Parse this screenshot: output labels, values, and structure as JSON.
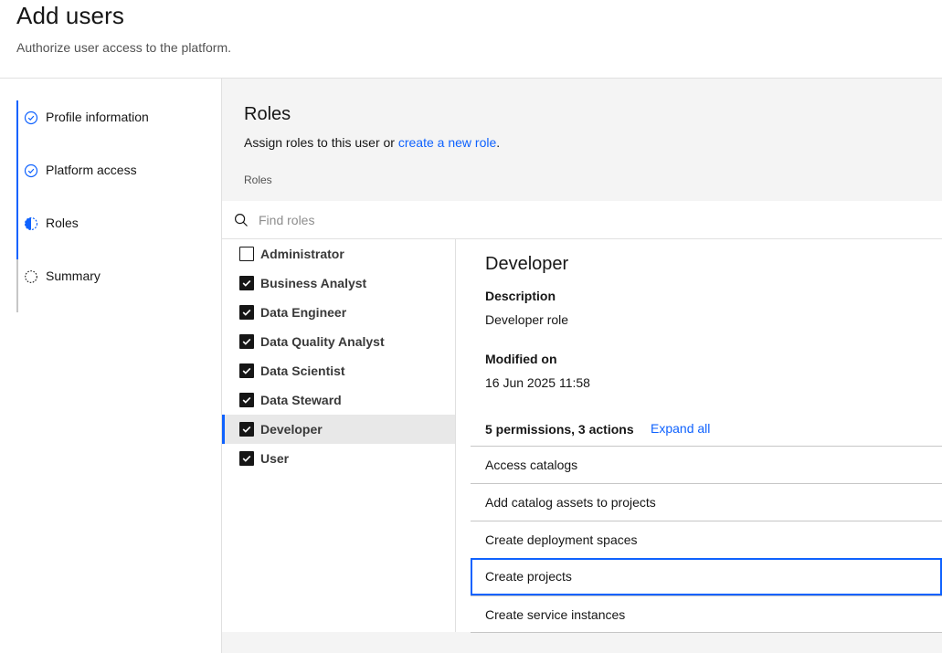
{
  "header": {
    "title": "Add users",
    "subtitle": "Authorize user access to the platform."
  },
  "steps": [
    {
      "label": "Profile information",
      "state": "complete",
      "icon": "checkmark-outline-icon"
    },
    {
      "label": "Platform access",
      "state": "complete",
      "icon": "checkmark-outline-icon"
    },
    {
      "label": "Roles",
      "state": "current",
      "icon": "incomplete-half-icon"
    },
    {
      "label": "Summary",
      "state": "incomplete",
      "icon": "circle-dash-icon"
    }
  ],
  "roles_section": {
    "title": "Roles",
    "description_prefix": "Assign roles to this user or ",
    "description_link": "create a new role",
    "description_suffix": ".",
    "field_label": "Roles",
    "search_placeholder": "Find roles"
  },
  "roles": [
    {
      "label": "Administrator",
      "checked": false
    },
    {
      "label": "Business Analyst",
      "checked": true
    },
    {
      "label": "Data Engineer",
      "checked": true
    },
    {
      "label": "Data Quality Analyst",
      "checked": true
    },
    {
      "label": "Data Scientist",
      "checked": true
    },
    {
      "label": "Data Steward",
      "checked": true
    },
    {
      "label": "Developer",
      "checked": true,
      "selected": true
    },
    {
      "label": "User",
      "checked": true
    }
  ],
  "detail": {
    "title": "Developer",
    "description_label": "Description",
    "description_value": "Developer role",
    "modified_label": "Modified on",
    "modified_value": "16 Jun 2025 11:58",
    "permissions_summary": "5 permissions, 3 actions",
    "expand_all_label": "Expand all",
    "permissions": [
      {
        "label": "Access catalogs"
      },
      {
        "label": "Add catalog assets to projects"
      },
      {
        "label": "Create deployment spaces"
      },
      {
        "label": "Create projects",
        "focused": true
      },
      {
        "label": "Create service instances"
      }
    ]
  },
  "colors": {
    "accent": "#0f62fe",
    "text": "#161616",
    "secondary_text": "#525252",
    "panel_bg": "#f4f4f4"
  }
}
